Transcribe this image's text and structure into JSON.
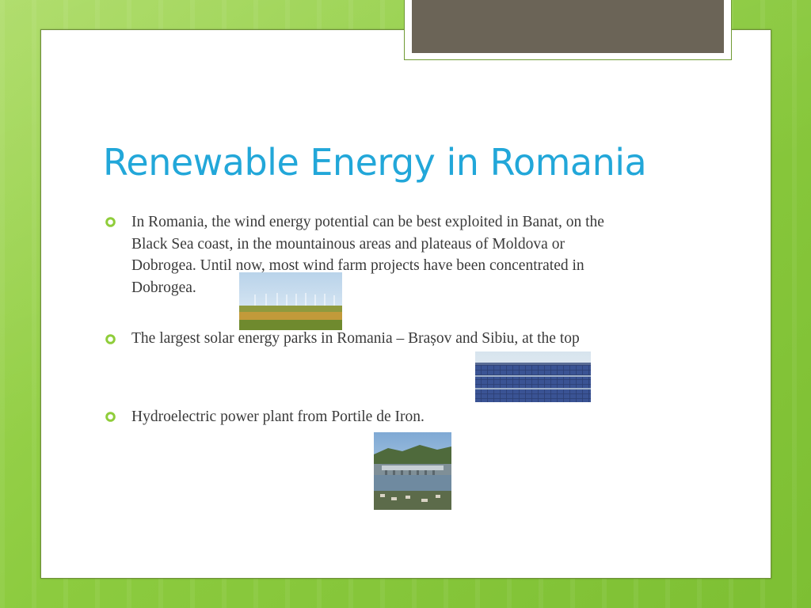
{
  "slide": {
    "title": "Renewable Energy in Romania",
    "bullets": [
      {
        "lines": [
          "In Romania, the wind energy potential can be best exploited in Banat, on the",
          "Black Sea coast, in the mountainous areas and plateaus of Moldova or",
          "Dobrogea. Until now, most wind farm projects have been concentrated in",
          "Dobrogea."
        ]
      },
      {
        "lines": [
          "The largest solar energy parks in Romania – Brașov and Sibiu, at the top"
        ]
      },
      {
        "lines": [
          "Hydroelectric power plant from Portile de Iron."
        ]
      }
    ]
  },
  "colors": {
    "title": "#22a7d9",
    "bullet_icon": "#8fcd3a",
    "text": "#3a3a3a",
    "background": "#8ccb3f"
  },
  "images": [
    "wind-farm-photo",
    "solar-park-photo",
    "hydro-plant-photo"
  ]
}
